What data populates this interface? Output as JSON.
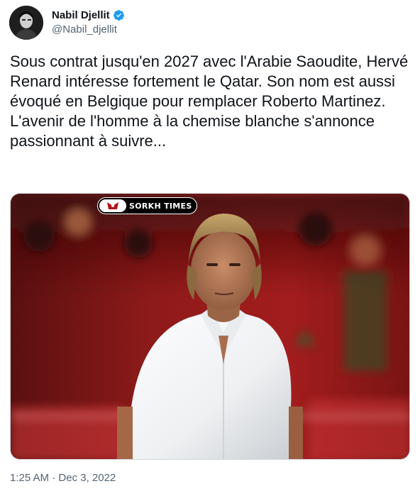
{
  "author": {
    "display_name": "Nabil Djellit",
    "handle": "@Nabil_djellit",
    "verified": true,
    "verified_color": "#1d9bf0"
  },
  "tweet": {
    "paragraphs": [
      "Sous contrat jusqu'en 2027 avec l'Arabie Saoudite, Hervé Renard intéresse fortement le Qatar. Son nom est aussi évoqué en Belgique pour remplacer Roberto Martinez.",
      "L'avenir de l'homme à la chemise blanche s'annonce passionnant à suivre..."
    ]
  },
  "media": {
    "watermark_text": "SORKH TIMES",
    "accent_color": "#b3151b"
  },
  "meta": {
    "time": "1:25 AM",
    "separator": "·",
    "date": "Dec 3, 2022"
  },
  "colors": {
    "text_primary": "#0f1419",
    "text_secondary": "#536471"
  }
}
